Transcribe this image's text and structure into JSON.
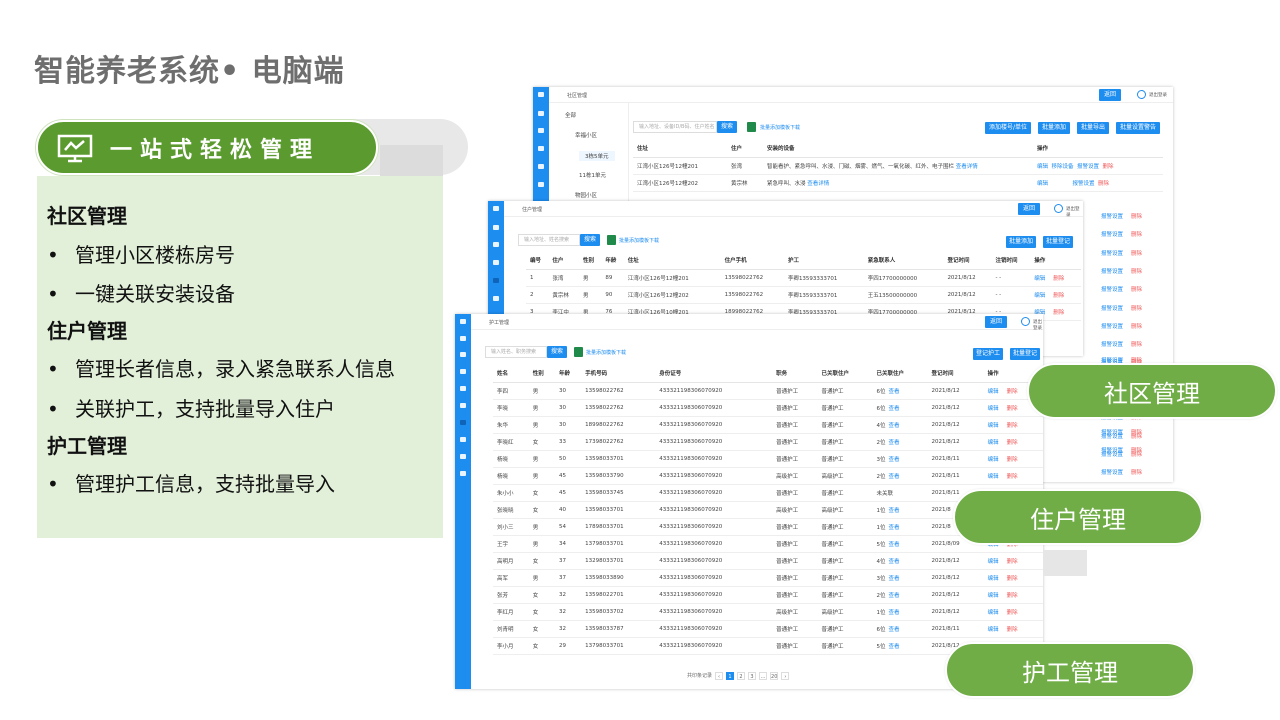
{
  "slide_title": "智能养老系统• 电脑端",
  "banner_label": "一站式轻松管理",
  "features": [
    {
      "heading": "社区管理",
      "bullets": [
        "管理小区楼栋房号",
        "一键关联安装设备"
      ]
    },
    {
      "heading": "住户管理",
      "bullets": [
        "管理长者信息，录入紧急联系人信息",
        "关联护工，支持批量导入住户"
      ]
    },
    {
      "heading": "护工管理",
      "bullets": [
        "管理护工信息，支持批量导入"
      ]
    }
  ],
  "bullet_glyph": "•",
  "captions": {
    "community": "社区管理",
    "resident": "住户管理",
    "caregiver": "护工管理"
  },
  "community_screen": {
    "breadcrumb": "社区管理",
    "back": "返回",
    "user": "退出登录",
    "tree": [
      "全部",
      "幸福小区",
      "3栋5单元",
      "11栋1单元",
      "物园小区"
    ],
    "search_placeholder": "输入地址、设备ID/B码、住户姓名",
    "search_btn": "搜索",
    "import_link": "批量添加模板下载",
    "actions": [
      "添加楼号/单位",
      "批量添加",
      "批量导出",
      "批量设置警告"
    ],
    "columns": [
      "住址",
      "住户",
      "安装的设备",
      "操作"
    ],
    "rows": [
      {
        "addr": "江湾小区126号12幢201",
        "name": "张湾",
        "devices": "智能看护、紧急呼叫、水浸、门磁、烟雾、燃气、一氧化碳、红外、电子围栏",
        "more": "查看详情",
        "ops": [
          "编辑",
          "移除设备",
          "报警设置",
          "删除"
        ]
      },
      {
        "addr": "江湾小区126号12幢202",
        "name": "黄宗林",
        "devices": "紧急呼叫、水浸",
        "more": "查看详情",
        "ops": [
          "编辑",
          "报警设置",
          "删除"
        ]
      }
    ],
    "side_ops": [
      "报警设置",
      "删除"
    ]
  },
  "resident_screen": {
    "breadcrumb": "住户管理",
    "back": "返回",
    "user": "退出登录",
    "search_placeholder": "输入地址、姓名搜索",
    "search_btn": "搜索",
    "import_link": "批量添加模板下载",
    "actions": [
      "批量添加",
      "批量登记"
    ],
    "columns": [
      "编号",
      "住户",
      "性别",
      "年龄",
      "住址",
      "住户手机",
      "护工",
      "紧急联系人",
      "登记时间",
      "注销时间",
      "操作"
    ],
    "rows": [
      [
        "1",
        "张湾",
        "男",
        "89",
        "江湾小区126号12幢201",
        "13598022762",
        "李卿13593333701",
        "李四17700000000",
        "2021/8/12",
        "- -"
      ],
      [
        "2",
        "黄宗林",
        "男",
        "90",
        "江湾小区126号12幢202",
        "13598022762",
        "李卿13593333701",
        "王五13500000000",
        "2021/8/12",
        "- -"
      ],
      [
        "3",
        "李江中",
        "男",
        "76",
        "江湾小区126号10幢201",
        "18998022762",
        "李卿13593333701",
        "李四17700000000",
        "2021/8/12",
        "- -"
      ]
    ],
    "ops": [
      "编辑",
      "删除"
    ]
  },
  "caregiver_screen": {
    "breadcrumb": "护工管理",
    "back": "返回",
    "user": "退出登录",
    "search_placeholder": "输入姓名、职务搜索",
    "search_btn": "搜索",
    "import_link": "批量添加模板下载",
    "actions": [
      "登记护工",
      "批量登记"
    ],
    "columns": [
      "姓名",
      "性别",
      "年龄",
      "手机号码",
      "身份证号",
      "职务",
      "已关联住户",
      "已关联住户",
      "登记时间",
      "操作"
    ],
    "view": "查看",
    "rows": [
      [
        "李四",
        "男",
        "30",
        "13598022762",
        "433321198306070920",
        "普通护工",
        "普通护工",
        "6位",
        "2021/8/12"
      ],
      [
        "李晓",
        "男",
        "30",
        "13598022762",
        "433321198306070920",
        "普通护工",
        "普通护工",
        "6位",
        "2021/8/12"
      ],
      [
        "朱华",
        "男",
        "30",
        "18998022762",
        "433321198306070920",
        "普通护工",
        "普通护工",
        "4位",
        "2021/8/12"
      ],
      [
        "李晓红",
        "女",
        "33",
        "17398022762",
        "433321198306070920",
        "普通护工",
        "普通护工",
        "2位",
        "2021/8/12"
      ],
      [
        "杨晓",
        "男",
        "50",
        "13598033701",
        "433321198306070920",
        "普通护工",
        "普通护工",
        "3位",
        "2021/8/11"
      ],
      [
        "杨晓",
        "男",
        "45",
        "13598033790",
        "433321198306070920",
        "高级护工",
        "高级护工",
        "2位",
        "2021/8/11"
      ],
      [
        "朱小小",
        "女",
        "45",
        "13598033745",
        "433321198306070920",
        "普通护工",
        "普通护工",
        "未关联",
        "2021/8/11"
      ],
      [
        "张晓晓",
        "女",
        "40",
        "13598033701",
        "433321198306070920",
        "高级护工",
        "高级护工",
        "1位",
        "2021/8"
      ],
      [
        "刘小三",
        "男",
        "54",
        "17898033701",
        "433321198306070920",
        "普通护工",
        "普通护工",
        "1位",
        "2021/8"
      ],
      [
        "王宇",
        "男",
        "34",
        "13798033701",
        "433321198306070920",
        "普通护工",
        "普通护工",
        "5位",
        "2021/8/09"
      ],
      [
        "高明月",
        "女",
        "37",
        "13298033701",
        "433321198306070920",
        "普通护工",
        "普通护工",
        "4位",
        "2021/8/12"
      ],
      [
        "高军",
        "男",
        "37",
        "13598033890",
        "433321198306070920",
        "普通护工",
        "普通护工",
        "3位",
        "2021/8/12"
      ],
      [
        "张芳",
        "女",
        "32",
        "13598022701",
        "433321198306070920",
        "普通护工",
        "普通护工",
        "2位",
        "2021/8/12"
      ],
      [
        "李红月",
        "女",
        "32",
        "13598033702",
        "433321198306070920",
        "高级护工",
        "高级护工",
        "1位",
        "2021/8/12"
      ],
      [
        "刘青明",
        "女",
        "32",
        "13598033787",
        "433321198306070920",
        "普通护工",
        "普通护工",
        "6位",
        "2021/8/11"
      ],
      [
        "李小月",
        "女",
        "29",
        "13798033701",
        "433321198306070920",
        "普通护工",
        "普通护工",
        "5位",
        "2021/8/12"
      ]
    ],
    "ops": [
      "编辑",
      "删除"
    ],
    "pager": {
      "summary": "共印条记录",
      "pages": [
        "‹",
        "1",
        "2",
        "3",
        "...",
        "20",
        "›"
      ]
    },
    "right_ops": [
      "报警设置",
      "删除"
    ]
  }
}
